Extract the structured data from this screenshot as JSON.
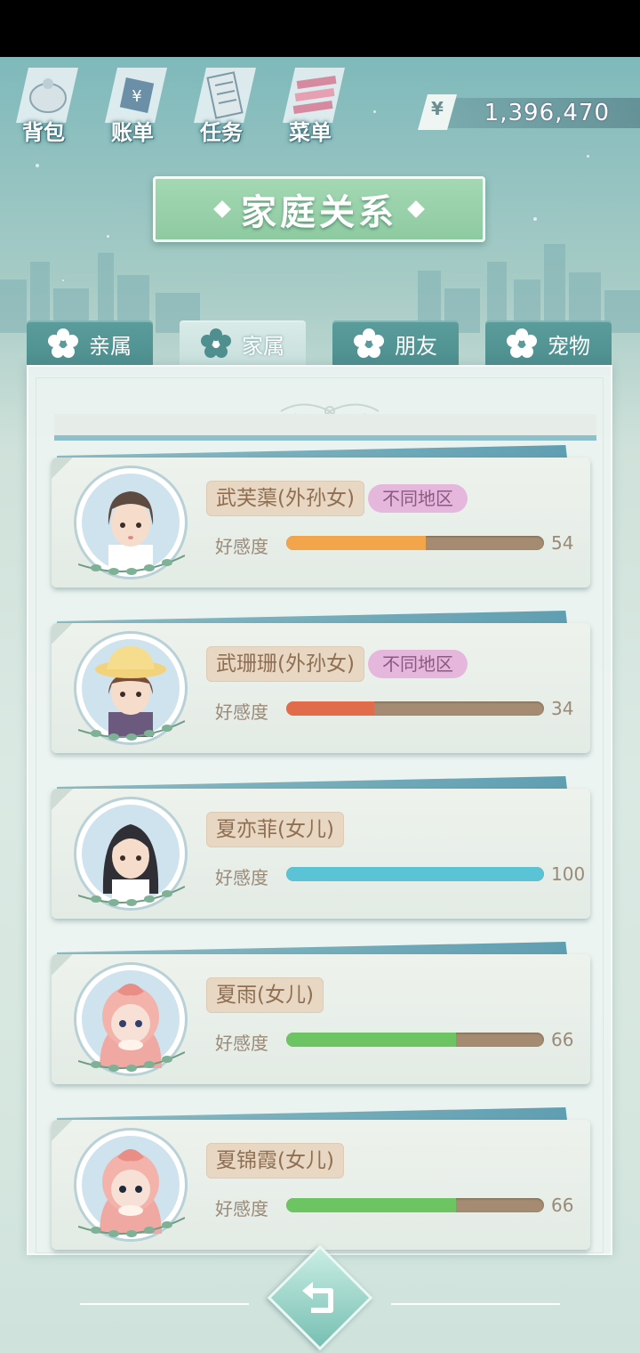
{
  "toolbar": {
    "items": [
      {
        "label": "背包",
        "icon": "backpack-icon"
      },
      {
        "label": "账单",
        "icon": "bill-icon"
      },
      {
        "label": "任务",
        "icon": "task-icon"
      },
      {
        "label": "菜单",
        "icon": "menu-icon"
      }
    ],
    "currency_symbol": "¥",
    "money": "1,396,470"
  },
  "title": "家庭关系",
  "tabs": [
    {
      "label": "亲属",
      "active": false
    },
    {
      "label": "家属",
      "active": true
    },
    {
      "label": "朋友",
      "active": false
    },
    {
      "label": "宠物",
      "active": false
    }
  ],
  "affinity_label": "好感度",
  "members": [
    {
      "name": "武芙蕖(外孙女)",
      "tag": "不同地区",
      "affinity": 54,
      "affinity_text": "54",
      "bar_color": "#f2a54a",
      "avatar": "girl-short-hair"
    },
    {
      "name": "武珊珊(外孙女)",
      "tag": "不同地区",
      "affinity": 34,
      "affinity_text": "34",
      "bar_color": "#e06c4c",
      "avatar": "girl-yellow-hat"
    },
    {
      "name": "夏亦菲(女儿)",
      "tag": "",
      "affinity": 100,
      "affinity_text": "100",
      "bar_color": "#5bc3d6",
      "avatar": "girl-long-dark-hair"
    },
    {
      "name": "夏雨(女儿)",
      "tag": "",
      "affinity": 66,
      "affinity_text": "66",
      "bar_color": "#6cc462",
      "avatar": "baby-pink-hood"
    },
    {
      "name": "夏锦霞(女儿)",
      "tag": "",
      "affinity": 66,
      "affinity_text": "66",
      "bar_color": "#6cc462",
      "avatar": "baby-pink-hood"
    }
  ],
  "colors": {
    "title_plate": "#9bd3ab",
    "tab_inactive": "#5a9c9b",
    "tab_active": "#d4e8e5",
    "name_tag": "#e8d7c3",
    "region_tag": "#e6b7dc"
  }
}
